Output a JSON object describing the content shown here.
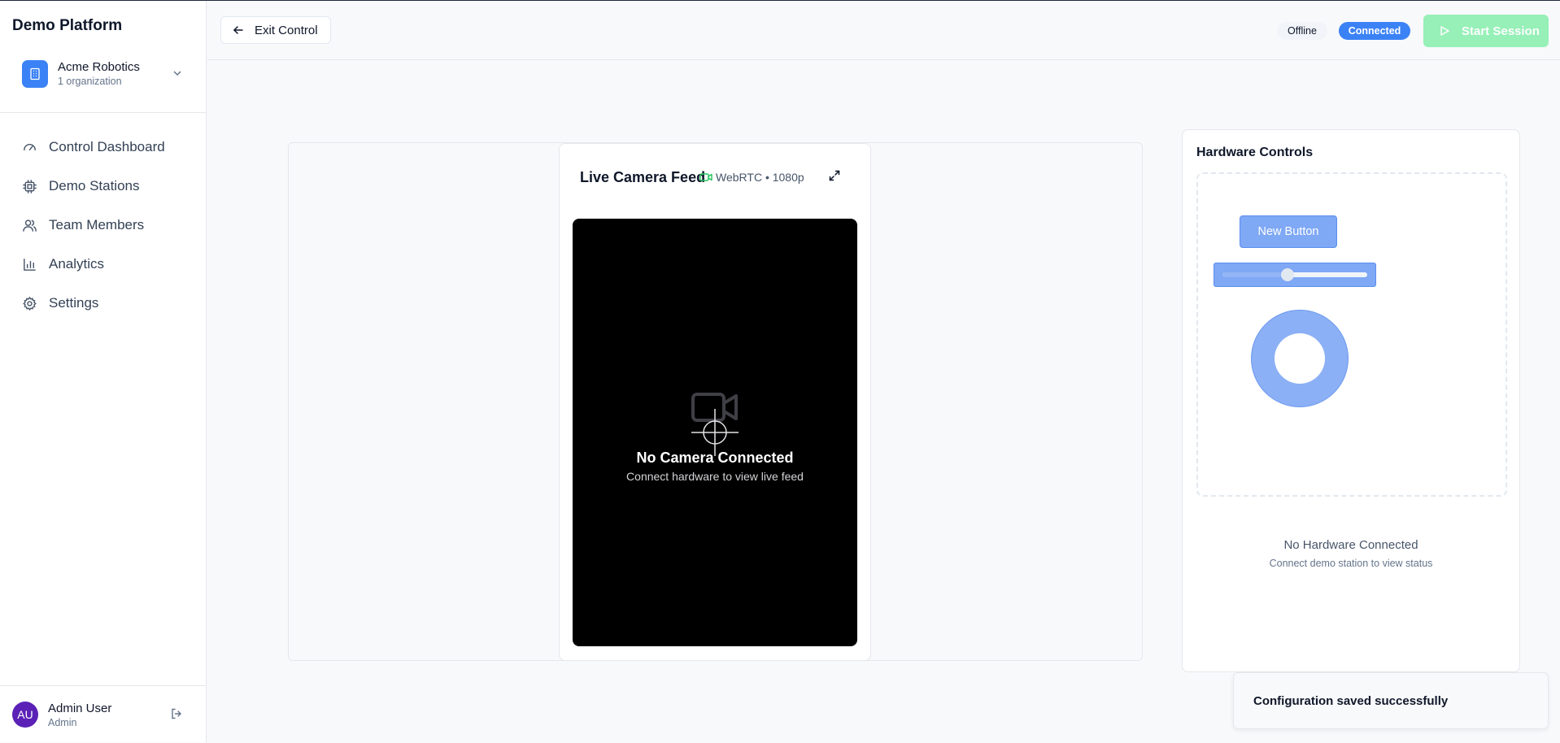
{
  "app": {
    "brand": "Demo Platform"
  },
  "org": {
    "name": "Acme Robotics",
    "count": "1 organization"
  },
  "nav": {
    "items": [
      {
        "label": "Control Dashboard",
        "icon": "gauge-icon"
      },
      {
        "label": "Demo Stations",
        "icon": "cpu-icon"
      },
      {
        "label": "Team Members",
        "icon": "users-icon"
      },
      {
        "label": "Analytics",
        "icon": "bar-chart-icon"
      },
      {
        "label": "Settings",
        "icon": "gear-icon"
      }
    ]
  },
  "user": {
    "initials": "AU",
    "name": "Admin User",
    "role": "Admin"
  },
  "header": {
    "exit_label": "Exit Control",
    "status_offline": "Offline",
    "status_connected": "Connected",
    "start_label": "Start Session"
  },
  "camera": {
    "title": "Live Camera Feed",
    "meta": "WebRTC • 1080p",
    "empty_title": "No Camera Connected",
    "empty_subtitle": "Connect hardware to view live feed"
  },
  "hardware": {
    "title": "Hardware Controls",
    "button_label": "New Button",
    "slider_value": 0.45,
    "empty_title": "No Hardware Connected",
    "empty_subtitle": "Connect demo station to view status"
  },
  "toast": {
    "message": "Configuration saved successfully"
  },
  "colors": {
    "primary": "#3b82f6",
    "success": "#86efac",
    "camera_accent": "#22c55e",
    "avatar": "#5b21b6"
  }
}
